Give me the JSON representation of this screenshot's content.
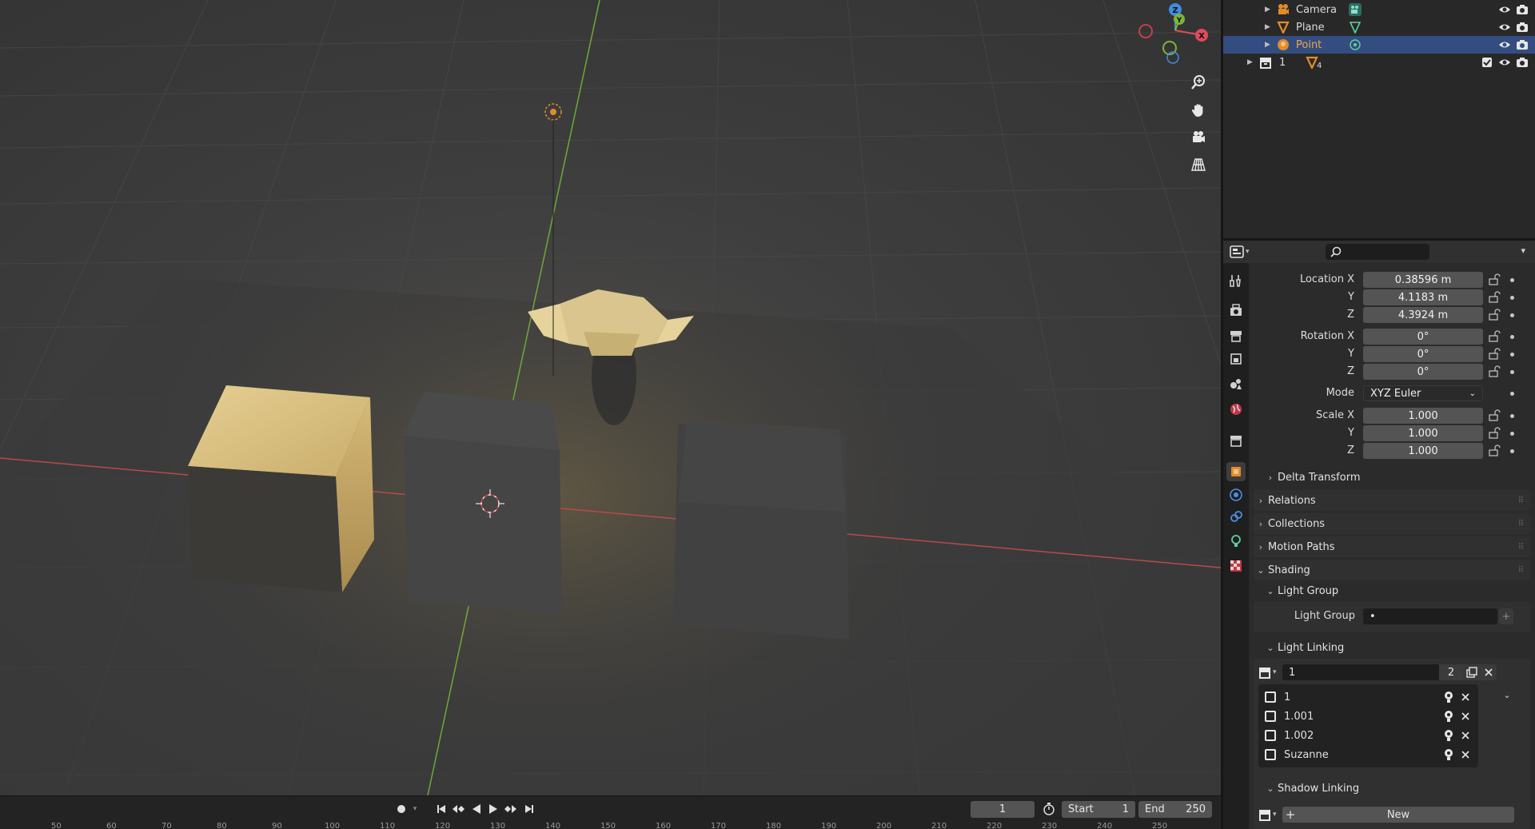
{
  "outliner": {
    "rows": [
      {
        "label": "Camera",
        "icon": "camera-icon",
        "data_icon": "camera-data-icon"
      },
      {
        "label": "Plane",
        "icon": "mesh-icon",
        "data_icon": "mesh-data-icon"
      },
      {
        "label": "Point",
        "icon": "light-icon",
        "data_icon": "light-data-icon",
        "selected": true
      },
      {
        "label": "1",
        "icon": "collection-icon",
        "data_icon": "mesh-data-icon",
        "badge": "4"
      }
    ]
  },
  "properties": {
    "search_placeholder": "",
    "location": {
      "label_x": "Location X",
      "label_y": "Y",
      "label_z": "Z",
      "x": "0.38596 m",
      "y": "4.1183 m",
      "z": "4.3924 m"
    },
    "rotation": {
      "label_x": "Rotation X",
      "label_y": "Y",
      "label_z": "Z",
      "x": "0°",
      "y": "0°",
      "z": "0°"
    },
    "mode": {
      "label": "Mode",
      "value": "XYZ Euler"
    },
    "scale": {
      "label_x": "Scale X",
      "label_y": "Y",
      "label_z": "Z",
      "x": "1.000",
      "y": "1.000",
      "z": "1.000"
    },
    "panels": {
      "delta_transform": "Delta Transform",
      "relations": "Relations",
      "collections": "Collections",
      "motion_paths": "Motion Paths",
      "shading": "Shading",
      "light_group": "Light Group",
      "light_group_field_label": "Light Group",
      "light_group_value": "•",
      "light_linking": "Light Linking",
      "shadow_linking": "Shadow Linking"
    },
    "light_linking": {
      "collection_name": "1",
      "user_count": "2",
      "items": [
        "1",
        "1.001",
        "1.002",
        "Suzanne"
      ]
    },
    "shadow_linking": {
      "new_label": "New"
    }
  },
  "timeline": {
    "current_frame": "1",
    "start_label": "Start",
    "start_value": "1",
    "end_label": "End",
    "end_value": "250",
    "ruler": [
      "50",
      "60",
      "70",
      "80",
      "90",
      "100",
      "110",
      "120",
      "130",
      "140",
      "150",
      "160",
      "170",
      "180",
      "190",
      "200",
      "210",
      "220",
      "230",
      "240",
      "250"
    ]
  },
  "gizmo": {
    "x_label": "X",
    "y_label": "Y",
    "z_label": "Z"
  },
  "colors": {
    "accent_selected": "#334d80",
    "x_axis": "#e04b5a",
    "y_axis": "#7fb33c",
    "z_axis": "#3f8ce0",
    "object_orange": "#e28b2b"
  }
}
